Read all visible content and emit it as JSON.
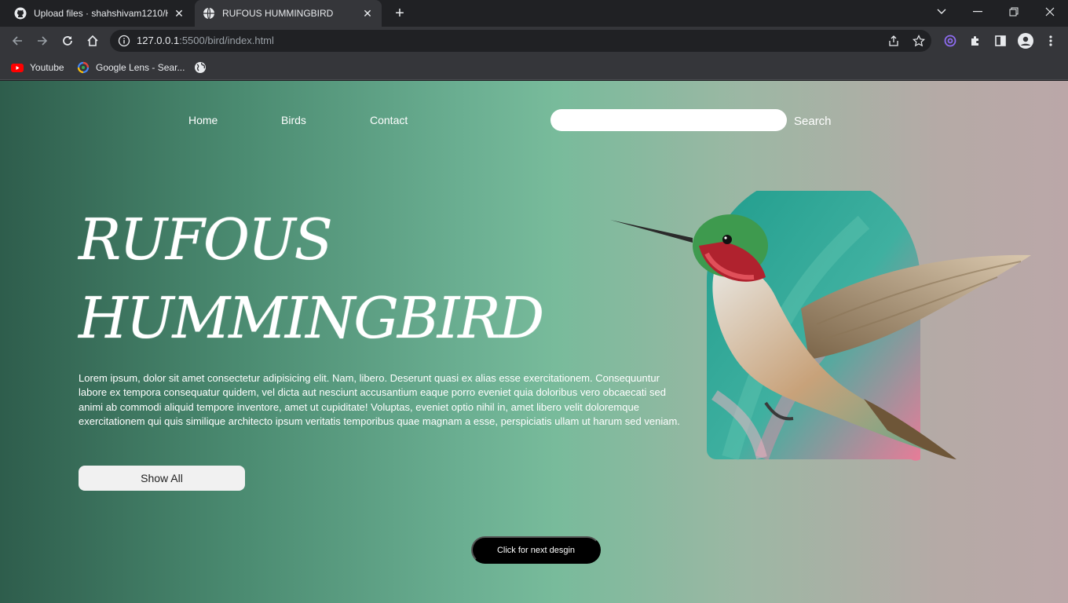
{
  "browser": {
    "tabs": [
      {
        "title": "Upload files · shahshivam1210/H",
        "active": false
      },
      {
        "title": "RUFOUS HUMMINGBIRD",
        "active": true
      }
    ],
    "address": {
      "host": "127.0.0.1",
      "path": ":5500/bird/index.html"
    },
    "bookmarks": [
      {
        "label": "Youtube",
        "icon": "youtube-icon"
      },
      {
        "label": "Google Lens - Sear...",
        "icon": "google-lens-icon"
      },
      {
        "label": "",
        "icon": "globe-icon"
      }
    ]
  },
  "page": {
    "nav": [
      "Home",
      "Birds",
      "Contact"
    ],
    "search": {
      "placeholder": "",
      "button": "Search"
    },
    "hero": {
      "title_line1": "RUFOUS",
      "title_line2": "HUMMINGBIRD",
      "description": "Lorem ipsum, dolor sit amet consectetur adipisicing elit. Nam, libero. Deserunt quasi ex alias esse exercitationem. Consequuntur labore ex tempora consequatur quidem, vel dicta aut nesciunt accusantium eaque porro eveniet quia doloribus vero obcaecati sed animi ab commodi aliquid tempore inventore, amet ut cupiditate! Voluptas, eveniet optio nihil in, amet libero velit doloremque exercitationem qui quis similique architecto ipsum veritatis temporibus quae magnam a esse, perspiciatis ullam ut harum sed veniam.",
      "show_all": "Show All"
    },
    "next_design": "Click for next desgin"
  },
  "colors": {
    "page_gradient_left": "#2e5d4c",
    "page_gradient_mid": "#78bb9b",
    "page_gradient_right": "#bba7a8",
    "next_button": "#000000"
  }
}
